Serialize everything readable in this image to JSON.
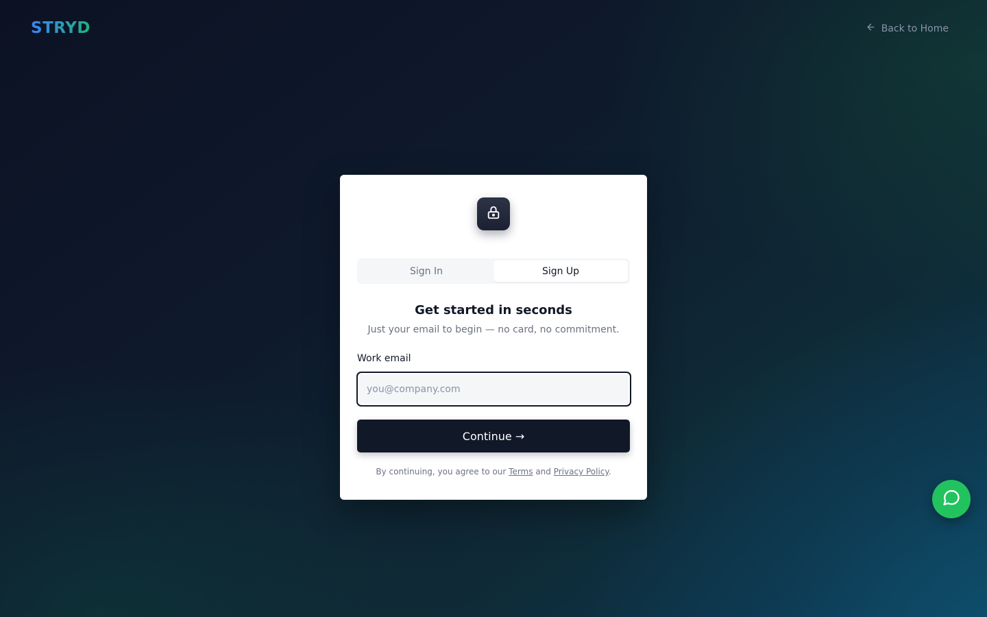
{
  "brand": {
    "name": "STRYD"
  },
  "header": {
    "back_label": "Back to Home"
  },
  "auth": {
    "tabs": [
      {
        "label": "Sign In",
        "active": false
      },
      {
        "label": "Sign Up",
        "active": true
      }
    ],
    "title": "Get started in seconds",
    "subtitle": "Just your email to begin — no card, no commitment.",
    "email": {
      "label": "Work email",
      "placeholder": "you@company.com",
      "value": ""
    },
    "submit_label": "Continue →",
    "terms": {
      "prefix": "By continuing, you agree to our ",
      "terms_link": "Terms",
      "middle": " and ",
      "privacy_link": "Privacy Policy",
      "suffix": "."
    }
  },
  "icons": {
    "back": "arrow-left-icon",
    "lock": "lock-icon",
    "chat": "chat-bubble-icon"
  },
  "colors": {
    "primary": "#111827",
    "chat_button": "#22c35e",
    "logo_gradient_start": "#3b82f6",
    "logo_gradient_end": "#1fb37a"
  }
}
